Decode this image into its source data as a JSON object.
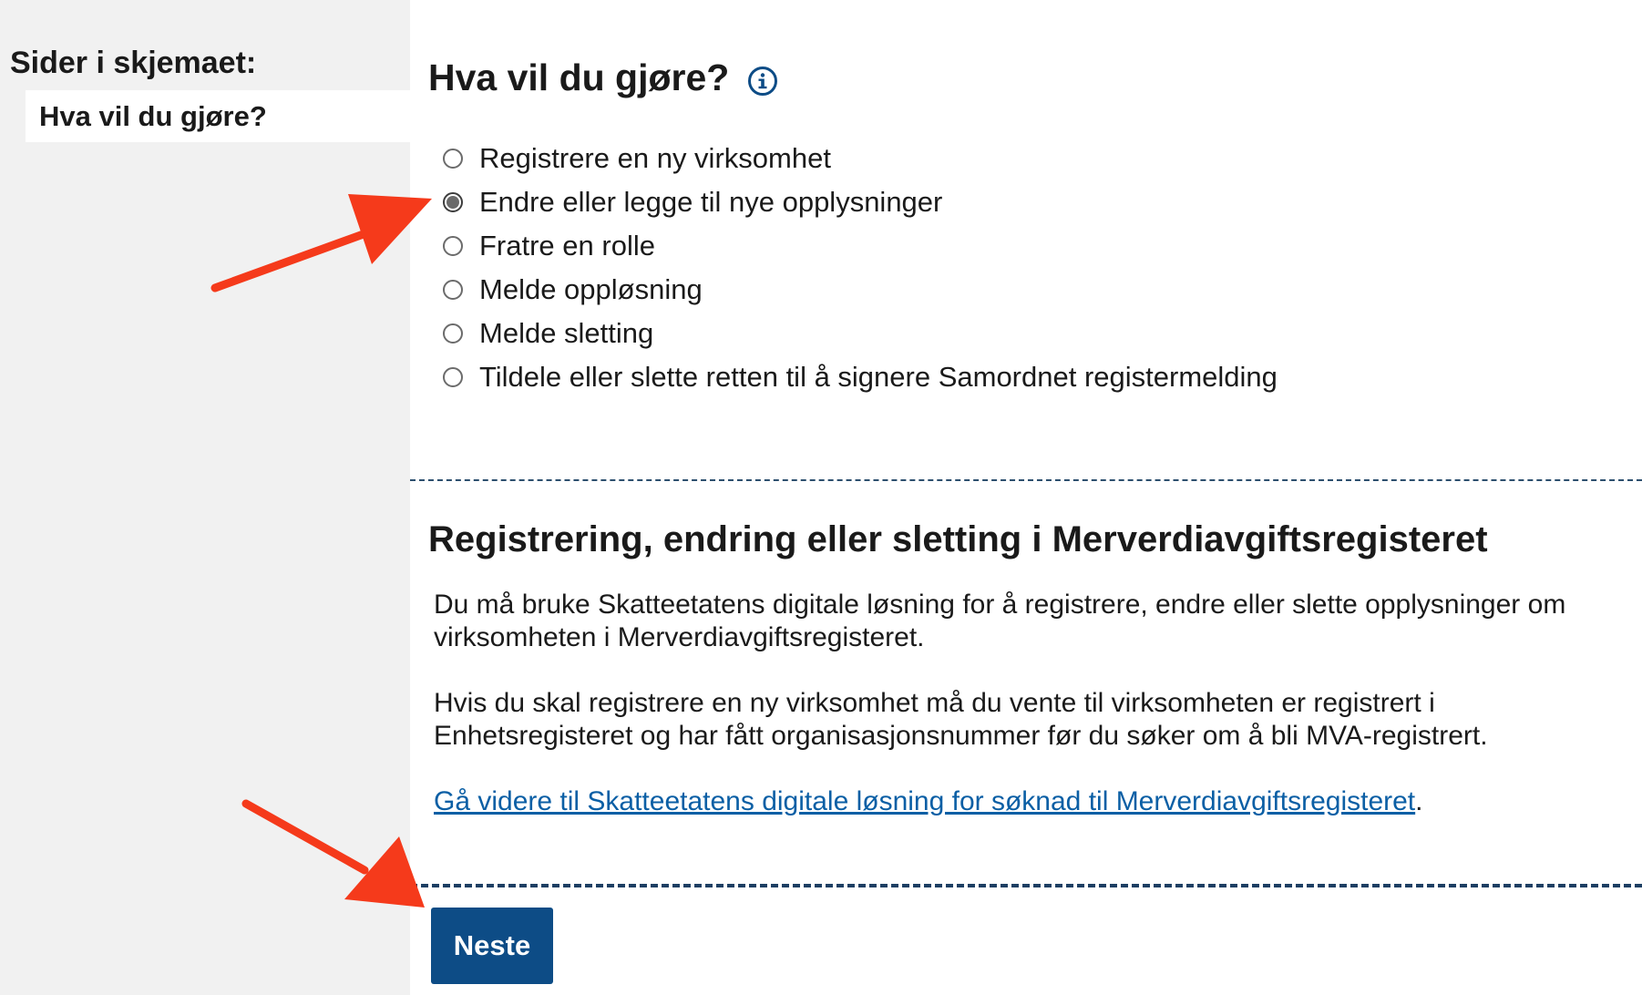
{
  "sidebar": {
    "heading": "Sider i skjemaet:",
    "items": [
      {
        "label": "Hva vil du gjøre?"
      }
    ]
  },
  "main": {
    "title": "Hva vil du gjøre?",
    "info_icon": "info-circle-icon",
    "options": [
      {
        "label": "Registrere en ny virksomhet",
        "checked": false
      },
      {
        "label": "Endre eller legge til nye opplysninger",
        "checked": true
      },
      {
        "label": "Fratre en rolle",
        "checked": false
      },
      {
        "label": "Melde oppløsning",
        "checked": false
      },
      {
        "label": "Melde sletting",
        "checked": false
      },
      {
        "label": "Tildele eller slette retten til å signere Samordnet registermelding",
        "checked": false
      }
    ],
    "section": {
      "title": "Registrering, endring eller sletting i Merverdiavgiftsregisteret",
      "paragraph1": "Du må bruke Skatteetatens digitale løsning for å registrere, endre eller slette opplysninger om virksomheten i Merverdiavgiftsregisteret.",
      "paragraph2": "Hvis du skal registrere en ny virksomhet må du vente til virksomheten er registrert i Enhetsregisteret og har fått organisasjonsnummer før du søker om å bli MVA-registrert.",
      "link_text": "Gå videre til Skatteetatens digitale løsning for søknad til Merverdiavgiftsregisteret",
      "link_suffix": "."
    },
    "next_button": "Neste"
  },
  "colors": {
    "sidebar_bg": "#f1f1f1",
    "button_bg": "#0d4c86",
    "link": "#0b5fa5",
    "divider": "#1d3f63",
    "annotation_arrow": "#f53a1b"
  }
}
